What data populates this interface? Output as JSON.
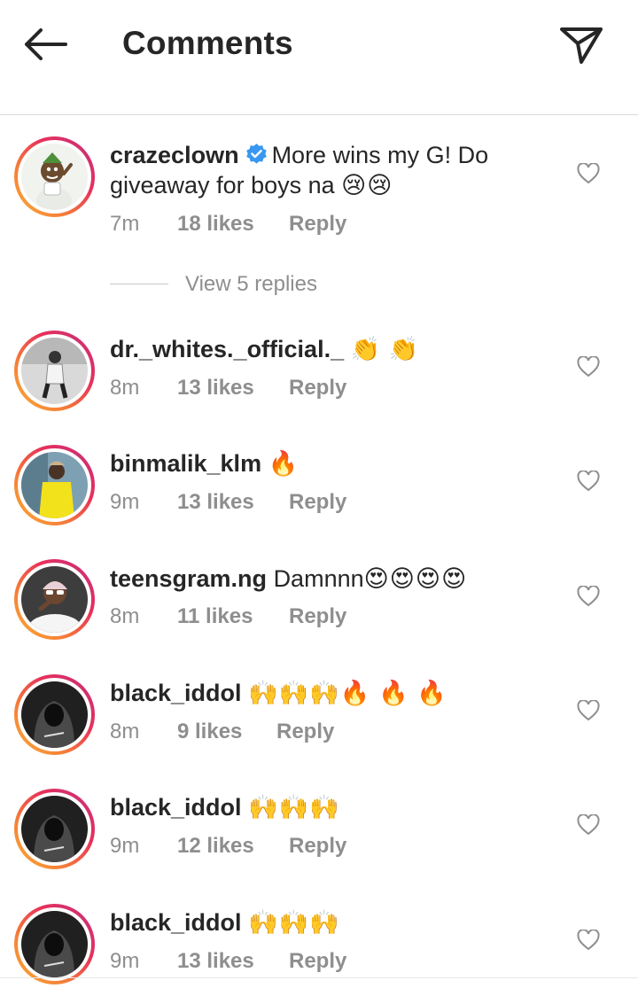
{
  "header": {
    "title": "Comments",
    "back_icon": "arrow-left-icon",
    "share_icon": "paper-plane-icon"
  },
  "colors": {
    "text": "#262626",
    "muted": "#8e8e8e",
    "verified": "#3897f0",
    "ring_start": "#f9b234",
    "ring_end": "#c2307f"
  },
  "view_replies": {
    "label": "View 5 replies"
  },
  "comments": [
    {
      "username": "crazeclown",
      "verified": true,
      "text": "More wins my G! Do giveaway for boys na",
      "emojis": "😢😢",
      "time": "7m",
      "likes": "18 likes",
      "reply": "Reply"
    },
    {
      "username": "dr._whites._official._",
      "verified": false,
      "text": "",
      "emojis": "👏 👏",
      "time": "8m",
      "likes": "13 likes",
      "reply": "Reply"
    },
    {
      "username": "binmalik_klm",
      "verified": false,
      "text": "",
      "emojis": "🔥",
      "time": "9m",
      "likes": "13 likes",
      "reply": "Reply"
    },
    {
      "username": "teensgram.ng",
      "verified": false,
      "text": "Damnnn",
      "emojis": "😍😍😍😍",
      "time": "8m",
      "likes": "11 likes",
      "reply": "Reply"
    },
    {
      "username": "black_iddol",
      "verified": false,
      "text": "",
      "emojis": "🙌🙌🙌🔥 🔥 🔥",
      "time": "8m",
      "likes": "9 likes",
      "reply": "Reply"
    },
    {
      "username": "black_iddol",
      "verified": false,
      "text": "",
      "emojis": "🙌🙌🙌",
      "time": "9m",
      "likes": "12 likes",
      "reply": "Reply"
    },
    {
      "username": "black_iddol",
      "verified": false,
      "text": "",
      "emojis": "🙌🙌🙌",
      "time": "9m",
      "likes": "13 likes",
      "reply": "Reply"
    }
  ]
}
